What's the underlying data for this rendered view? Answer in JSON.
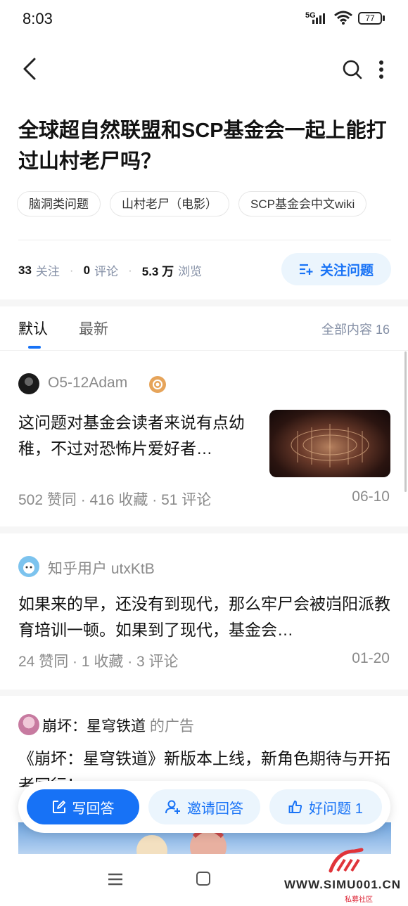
{
  "status_bar": {
    "time": "8:03",
    "network": "5G",
    "battery": "77"
  },
  "question": {
    "title": "全球超自然联盟和SCP基金会一起上能打过山村老尸吗？",
    "tags": [
      "脑洞类问题",
      "山村老尸（电影）",
      "SCP基金会中文wiki"
    ],
    "stats": {
      "followers_value": "33",
      "followers_label": "关注",
      "comments_value": "0",
      "comments_label": "评论",
      "views_value": "5.3 万",
      "views_label": "浏览"
    },
    "follow_button": "关注问题"
  },
  "tabs": {
    "default_label": "默认",
    "latest_label": "最新",
    "all_count": "全部内容 16"
  },
  "answers": [
    {
      "author": "O5-12Adam",
      "excerpt": "这问题对基金会读者来说有点幼稚，不过对恐怖片爱好者…",
      "meta": "502 赞同 · 416 收藏 · 51 评论",
      "date": "06-10"
    },
    {
      "author": "知乎用户 utxKtB",
      "excerpt": "如果来的早，还没有到现代，那么牢尸会被岿阳派教育培训一顿。如果到了现代，基金会…",
      "meta": "24 赞同 · 1 收藏 · 3 评论",
      "date": "01-20"
    }
  ],
  "ad": {
    "advertiser": "崩坏：星穹铁道",
    "suffix": "的广告",
    "text": "《崩坏：星穹铁道》新版本上线，新角色期待与开拓者同行！"
  },
  "action_bar": {
    "write_label": "写回答",
    "invite_label": "邀请回答",
    "good_label": "好问题 1"
  },
  "watermark": {
    "site": "WWW.SIMU001.CN",
    "sub": "私募社区"
  },
  "colors": {
    "accent": "#1772f6",
    "accent_light": "#ebf5fd",
    "muted": "#8a8a8a"
  },
  "icons": [
    "back-icon",
    "search-icon",
    "more-icon",
    "follow-list-icon",
    "badge-icon",
    "edit-icon",
    "invite-icon",
    "thumb-up-icon",
    "menu-icon",
    "home-icon"
  ]
}
